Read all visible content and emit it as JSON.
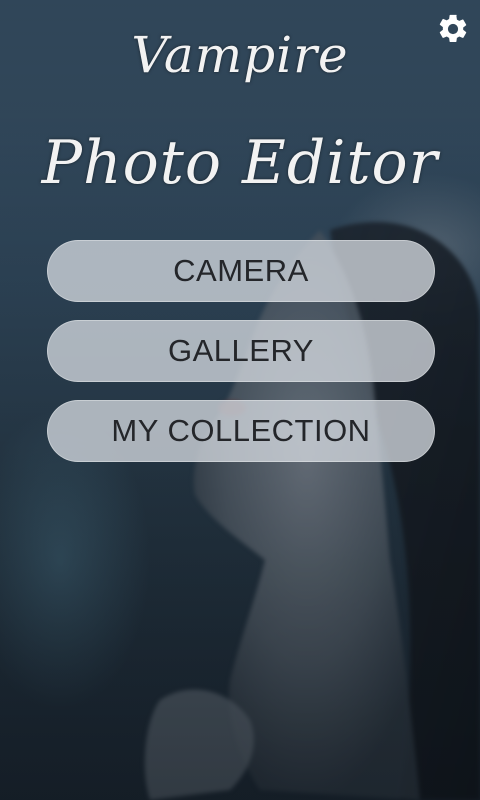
{
  "app": {
    "title_line1": "Vampire",
    "title_line2": "Photo Editor"
  },
  "header": {
    "settings_icon": "gear-icon"
  },
  "menu": {
    "camera_label": "CAMERA",
    "gallery_label": "GALLERY",
    "collection_label": "MY COLLECTION"
  },
  "colors": {
    "button_bg": "#d2d7de",
    "button_text": "#24262a",
    "title_text": "#f2f2f2",
    "background": "#2b4052"
  }
}
